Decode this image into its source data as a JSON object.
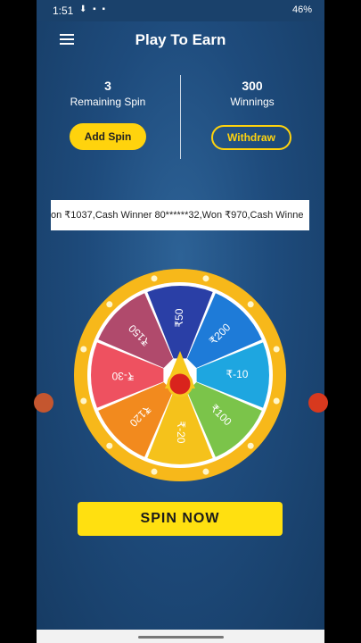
{
  "status_bar": {
    "time": "1:51",
    "notif_icons": "⬇ ▪ ▪",
    "right": "46%"
  },
  "header": {
    "title": "Play To Earn"
  },
  "stats": {
    "remaining_count": "3",
    "remaining_label": "Remaining Spin",
    "winnings_count": "300",
    "winnings_label": "Winnings"
  },
  "buttons": {
    "add_spin": "Add Spin",
    "withdraw": "Withdraw",
    "spin_now": "SPIN NOW"
  },
  "ticker": {
    "text": "on ₹1037,Cash Winner 80******32,Won ₹970,Cash Winne"
  },
  "wheel": {
    "segments": [
      {
        "label": "₹50",
        "color": "#2a3fa6"
      },
      {
        "label": "₹200",
        "color": "#1e7bd8"
      },
      {
        "label": "₹-10",
        "color": "#1ea6e0"
      },
      {
        "label": "₹100",
        "color": "#7bc44a"
      },
      {
        "label": "₹-20",
        "color": "#f5c21b"
      },
      {
        "label": "₹120",
        "color": "#f28a1e"
      },
      {
        "label": "₹-30",
        "color": "#ee5160"
      },
      {
        "label": "₹150",
        "color": "#b04a6c"
      }
    ],
    "rim_color": "#f7b81a",
    "pointer_color": "#f7c81e",
    "hub_color": "#d9231d"
  }
}
